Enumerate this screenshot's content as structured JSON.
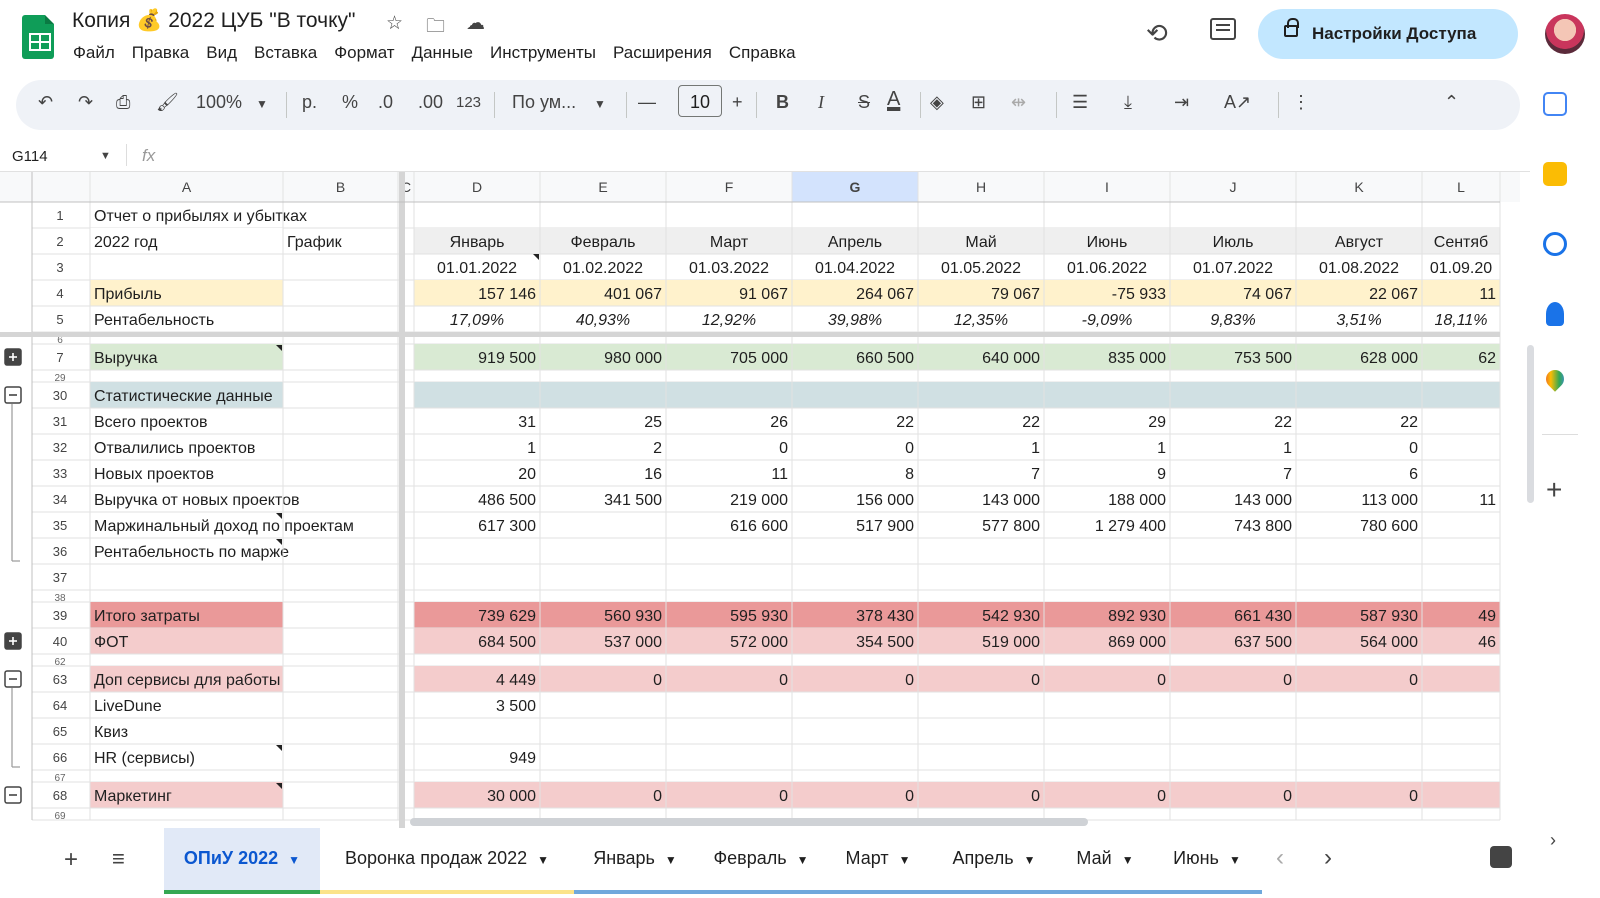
{
  "header": {
    "title": "Копия 💰 2022 ЦУБ \"В точку\"",
    "menu": [
      "Файл",
      "Правка",
      "Вид",
      "Вставка",
      "Формат",
      "Данные",
      "Инструменты",
      "Расширения",
      "Справка"
    ],
    "share_label": "Настройки Доступа",
    "icons": [
      "star-icon",
      "move-folder-icon",
      "cloud-icon",
      "history-icon",
      "comment-icon",
      "lock-icon"
    ]
  },
  "toolbar": {
    "zoom": "100%",
    "currency": "р.",
    "percent": "%",
    "dec_less": ".0",
    "dec_more": ".00",
    "number_format": "123",
    "font": "По ум...",
    "font_size": "10",
    "bold": "B",
    "italic": "I",
    "strike": "S",
    "text_color": "A",
    "accent": "#0b57d0"
  },
  "formula": {
    "cell_ref": "G114",
    "fx": "fx"
  },
  "grid": {
    "col_letters": [
      "A",
      "B",
      "C",
      "D",
      "E",
      "F",
      "G",
      "H",
      "I",
      "J",
      "K",
      "L"
    ],
    "selected_col": "G",
    "rows": [
      {
        "n": "1",
        "a": "Отчет о прибылях и убытках",
        "b": "",
        "vals": [
          "",
          "",
          "",
          "",
          "",
          "",
          "",
          "",
          ""
        ],
        "fill": "",
        "style": "",
        "group": ""
      },
      {
        "n": "2",
        "a": "2022 год",
        "b": "График",
        "vals": [
          "Январь",
          "Февраль",
          "Март",
          "Апрель",
          "Май",
          "Июнь",
          "Июль",
          "Август",
          "Сентяб"
        ],
        "fill": "#efefef",
        "style": "center",
        "group": ""
      },
      {
        "n": "3",
        "a": "",
        "b": "",
        "vals": [
          "01.01.2022",
          "01.02.2022",
          "01.03.2022",
          "01.04.2022",
          "01.05.2022",
          "01.06.2022",
          "01.07.2022",
          "01.08.2022",
          "01.09.20"
        ],
        "fill": "",
        "style": "center",
        "group": ""
      },
      {
        "n": "4",
        "a": "Прибыль",
        "b": "",
        "vals": [
          "157 146",
          "401 067",
          "91 067",
          "264 067",
          "79 067",
          "-75 933",
          "74 067",
          "22 067",
          "11"
        ],
        "fill": "#fff2cc",
        "style": "",
        "group": ""
      },
      {
        "n": "5",
        "a": "Рентабельность",
        "b": "",
        "vals": [
          "17,09%",
          "40,93%",
          "12,92%",
          "39,98%",
          "12,35%",
          "-9,09%",
          "9,83%",
          "3,51%",
          "18,11%"
        ],
        "fill": "",
        "style": "italic-center",
        "group": ""
      },
      {
        "n": "6",
        "a": "",
        "b": "",
        "vals": [
          "",
          "",
          "",
          "",
          "",
          "",
          "",
          "",
          ""
        ],
        "fill": "",
        "style": "",
        "group": "",
        "thin": true
      },
      {
        "n": "7",
        "a": "Выручка",
        "b": "",
        "vals": [
          "919 500",
          "980 000",
          "705 000",
          "660 500",
          "640 000",
          "835 000",
          "753 500",
          "628 000",
          "62"
        ],
        "fill": "#d9ead3",
        "style": "",
        "group": "plus"
      },
      {
        "n": "29",
        "a": "",
        "b": "",
        "vals": [
          "",
          "",
          "",
          "",
          "",
          "",
          "",
          "",
          ""
        ],
        "fill": "",
        "style": "",
        "group": "",
        "thin": true
      },
      {
        "n": "30",
        "a": "Статистические данные",
        "b": "",
        "vals": [
          "",
          "",
          "",
          "",
          "",
          "",
          "",
          "",
          ""
        ],
        "fill": "#d0e0e3",
        "style": "",
        "group": "minus"
      },
      {
        "n": "31",
        "a": "Всего проектов",
        "b": "",
        "vals": [
          "31",
          "25",
          "26",
          "22",
          "22",
          "29",
          "22",
          "22",
          ""
        ],
        "fill": "",
        "style": "",
        "group": "line"
      },
      {
        "n": "32",
        "a": "Отвалились проектов",
        "b": "",
        "vals": [
          "1",
          "2",
          "0",
          "0",
          "1",
          "1",
          "1",
          "0",
          ""
        ],
        "fill": "",
        "style": "",
        "group": "line"
      },
      {
        "n": "33",
        "a": "Новых проектов",
        "b": "",
        "vals": [
          "20",
          "16",
          "11",
          "8",
          "7",
          "9",
          "7",
          "6",
          ""
        ],
        "fill": "",
        "style": "",
        "group": "line"
      },
      {
        "n": "34",
        "a": "Выручка от новых проектов",
        "b": "",
        "vals": [
          "486 500",
          "341 500",
          "219 000",
          "156 000",
          "143 000",
          "188 000",
          "143 000",
          "113 000",
          "11"
        ],
        "fill": "",
        "style": "",
        "group": "line"
      },
      {
        "n": "35",
        "a": "Маржинальный доход по проектам",
        "b": "",
        "vals": [
          "617 300",
          "",
          "616 600",
          "517 900",
          "577 800",
          "1 279 400",
          "743 800",
          "780 600",
          ""
        ],
        "fill": "",
        "style": "",
        "group": "line"
      },
      {
        "n": "36",
        "a": "Рентабельность по марже",
        "b": "",
        "vals": [
          "",
          "",
          "",
          "",
          "",
          "",
          "",
          "",
          ""
        ],
        "fill": "",
        "style": "",
        "group": "end"
      },
      {
        "n": "37",
        "a": "",
        "b": "",
        "vals": [
          "",
          "",
          "",
          "",
          "",
          "",
          "",
          "",
          ""
        ],
        "fill": "",
        "style": "",
        "group": ""
      },
      {
        "n": "38",
        "a": "",
        "b": "",
        "vals": [
          "",
          "",
          "",
          "",
          "",
          "",
          "",
          "",
          ""
        ],
        "fill": "",
        "style": "",
        "group": "",
        "thin": true
      },
      {
        "n": "39",
        "a": "Итого затраты",
        "b": "",
        "vals": [
          "739 629",
          "560 930",
          "595 930",
          "378 430",
          "542 930",
          "892 930",
          "661 430",
          "587 930",
          "49"
        ],
        "fill": "#ea9999",
        "style": "",
        "group": ""
      },
      {
        "n": "40",
        "a": "ФОТ",
        "b": "",
        "vals": [
          "684 500",
          "537 000",
          "572 000",
          "354 500",
          "519 000",
          "869 000",
          "637 500",
          "564 000",
          "46"
        ],
        "fill": "#f4cccc",
        "style": "",
        "group": "plus"
      },
      {
        "n": "62",
        "a": "",
        "b": "",
        "vals": [
          "",
          "",
          "",
          "",
          "",
          "",
          "",
          "",
          ""
        ],
        "fill": "",
        "style": "",
        "group": "",
        "thin": true
      },
      {
        "n": "63",
        "a": "Доп сервисы для работы",
        "b": "",
        "vals": [
          "4 449",
          "0",
          "0",
          "0",
          "0",
          "0",
          "0",
          "0",
          ""
        ],
        "fill": "#f4cccc",
        "style": "",
        "group": "minus"
      },
      {
        "n": "64",
        "a": "LiveDune",
        "b": "",
        "vals": [
          "3 500",
          "",
          "",
          "",
          "",
          "",
          "",
          "",
          ""
        ],
        "fill": "",
        "style": "",
        "group": "line"
      },
      {
        "n": "65",
        "a": "Квиз",
        "b": "",
        "vals": [
          "",
          "",
          "",
          "",
          "",
          "",
          "",
          "",
          ""
        ],
        "fill": "",
        "style": "",
        "group": "line"
      },
      {
        "n": "66",
        "a": "HR (сервисы)",
        "b": "",
        "vals": [
          "949",
          "",
          "",
          "",
          "",
          "",
          "",
          "",
          ""
        ],
        "fill": "",
        "style": "",
        "group": "end"
      },
      {
        "n": "67",
        "a": "",
        "b": "",
        "vals": [
          "",
          "",
          "",
          "",
          "",
          "",
          "",
          "",
          ""
        ],
        "fill": "",
        "style": "",
        "group": "",
        "thin": true
      },
      {
        "n": "68",
        "a": "Маркетинг",
        "b": "",
        "vals": [
          "30 000",
          "0",
          "0",
          "0",
          "0",
          "0",
          "0",
          "0",
          ""
        ],
        "fill": "#f4cccc",
        "style": "",
        "group": "minus"
      },
      {
        "n": "69",
        "a": "",
        "b": "",
        "vals": [
          "",
          "",
          "",
          "",
          "",
          "",
          "",
          "",
          ""
        ],
        "fill": "",
        "style": "",
        "group": "",
        "thin": true
      }
    ]
  },
  "tabs": [
    {
      "label": "ОПиУ 2022",
      "active": true,
      "color": "#34a853"
    },
    {
      "label": "Воронка продаж 2022",
      "active": false,
      "color": "#fbe38a"
    },
    {
      "label": "Январь",
      "active": false,
      "color": "#6fa8dc"
    },
    {
      "label": "Февраль",
      "active": false,
      "color": "#6fa8dc"
    },
    {
      "label": "Март",
      "active": false,
      "color": "#6fa8dc"
    },
    {
      "label": "Апрель",
      "active": false,
      "color": "#6fa8dc"
    },
    {
      "label": "Май",
      "active": false,
      "color": "#6fa8dc"
    },
    {
      "label": "Июнь",
      "active": false,
      "color": "#6fa8dc"
    }
  ]
}
